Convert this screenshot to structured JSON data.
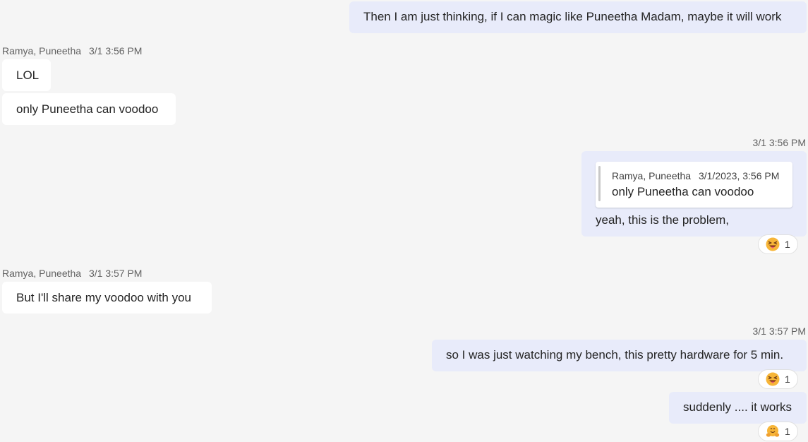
{
  "messages": {
    "m1_text": "Then I am just thinking, if I can magic like Puneetha Madam, maybe it will work",
    "g1_sender": "Ramya, Puneetha",
    "g1_time": "3/1 3:56 PM",
    "m2_text": "LOL",
    "m3_text": "only Puneetha can voodoo",
    "g2_time": "3/1 3:56 PM",
    "quote_sender": "Ramya, Puneetha",
    "quote_time": "3/1/2023, 3:56 PM",
    "quote_text": "only Puneetha can voodoo",
    "m4_text": "yeah, this is the problem,",
    "m4_reaction_count": "1",
    "g3_sender": "Ramya, Puneetha",
    "g3_time": "3/1 3:57 PM",
    "m5_text": "But I'll share my voodoo with you",
    "g4_time": "3/1 3:57 PM",
    "m6_text": "so I was just watching my bench, this pretty hardware for 5 min.",
    "m6_reaction_count": "1",
    "m7_text": "suddenly .... it works",
    "m7_reaction_count": "1"
  },
  "reactions": {
    "m4": "squinting-tongue-emoji",
    "m6": "squinting-tongue-emoji",
    "m7": "hugging-emoji"
  },
  "colors": {
    "background": "#f5f5f5",
    "incoming_bubble": "#ffffff",
    "outgoing_bubble": "#e8ebfa"
  }
}
